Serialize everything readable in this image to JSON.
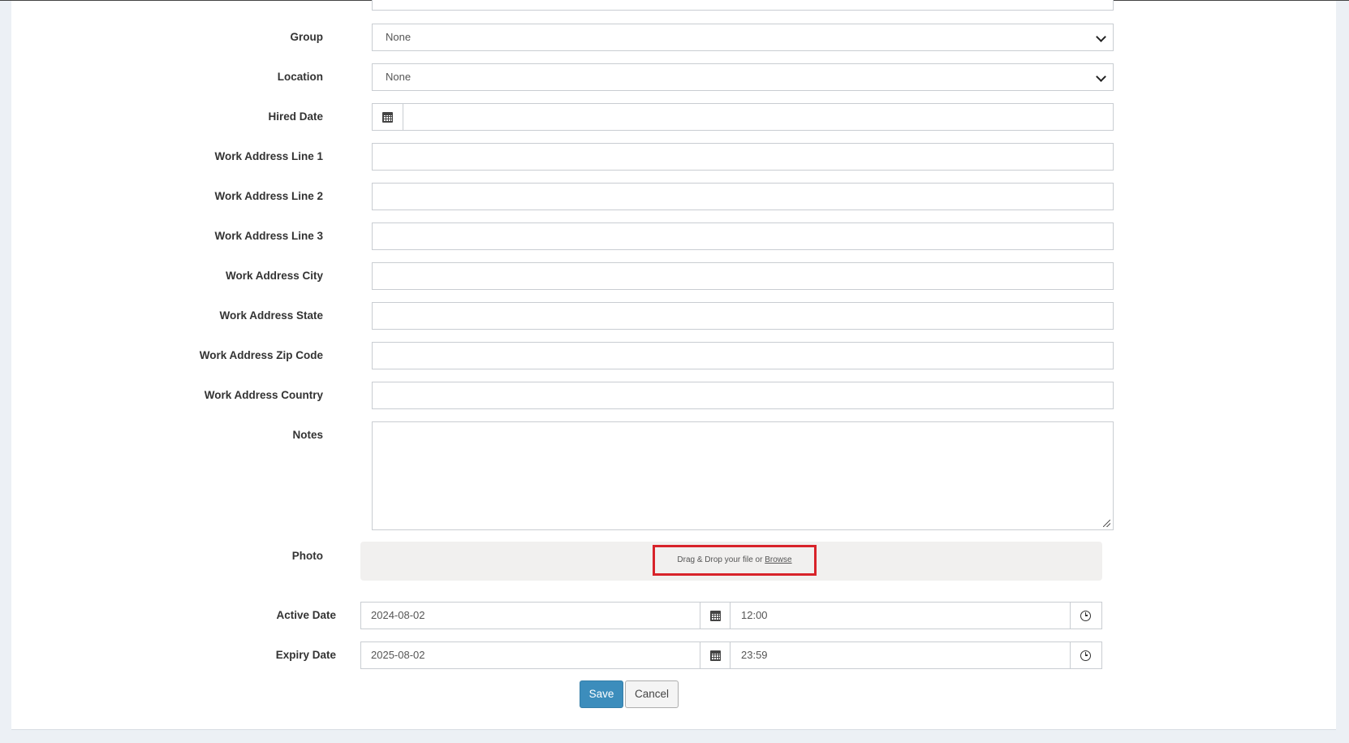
{
  "form": {
    "group": {
      "label": "Group",
      "value": "None"
    },
    "location": {
      "label": "Location",
      "value": "None"
    },
    "hired_date": {
      "label": "Hired Date",
      "value": ""
    },
    "work_address_1": {
      "label": "Work Address Line 1",
      "value": ""
    },
    "work_address_2": {
      "label": "Work Address Line 2",
      "value": ""
    },
    "work_address_3": {
      "label": "Work Address Line 3",
      "value": ""
    },
    "work_city": {
      "label": "Work Address City",
      "value": ""
    },
    "work_state": {
      "label": "Work Address State",
      "value": ""
    },
    "work_zip": {
      "label": "Work Address Zip Code",
      "value": ""
    },
    "work_country": {
      "label": "Work Address Country",
      "value": ""
    },
    "notes": {
      "label": "Notes",
      "value": ""
    },
    "photo": {
      "label": "Photo",
      "drop_text": "Drag & Drop your file or",
      "browse": "Browse"
    },
    "active_date": {
      "label": "Active Date",
      "date": "2024-08-02",
      "time": "12:00"
    },
    "expiry_date": {
      "label": "Expiry Date",
      "date": "2025-08-02",
      "time": "23:59"
    }
  },
  "buttons": {
    "save": "Save",
    "cancel": "Cancel"
  },
  "icons": {
    "calendar": "calendar-icon",
    "clock": "clock-icon",
    "dropdown": "chevron-down-icon"
  },
  "colors": {
    "primary": "#3c8dbc",
    "highlight": "#d8232a"
  }
}
